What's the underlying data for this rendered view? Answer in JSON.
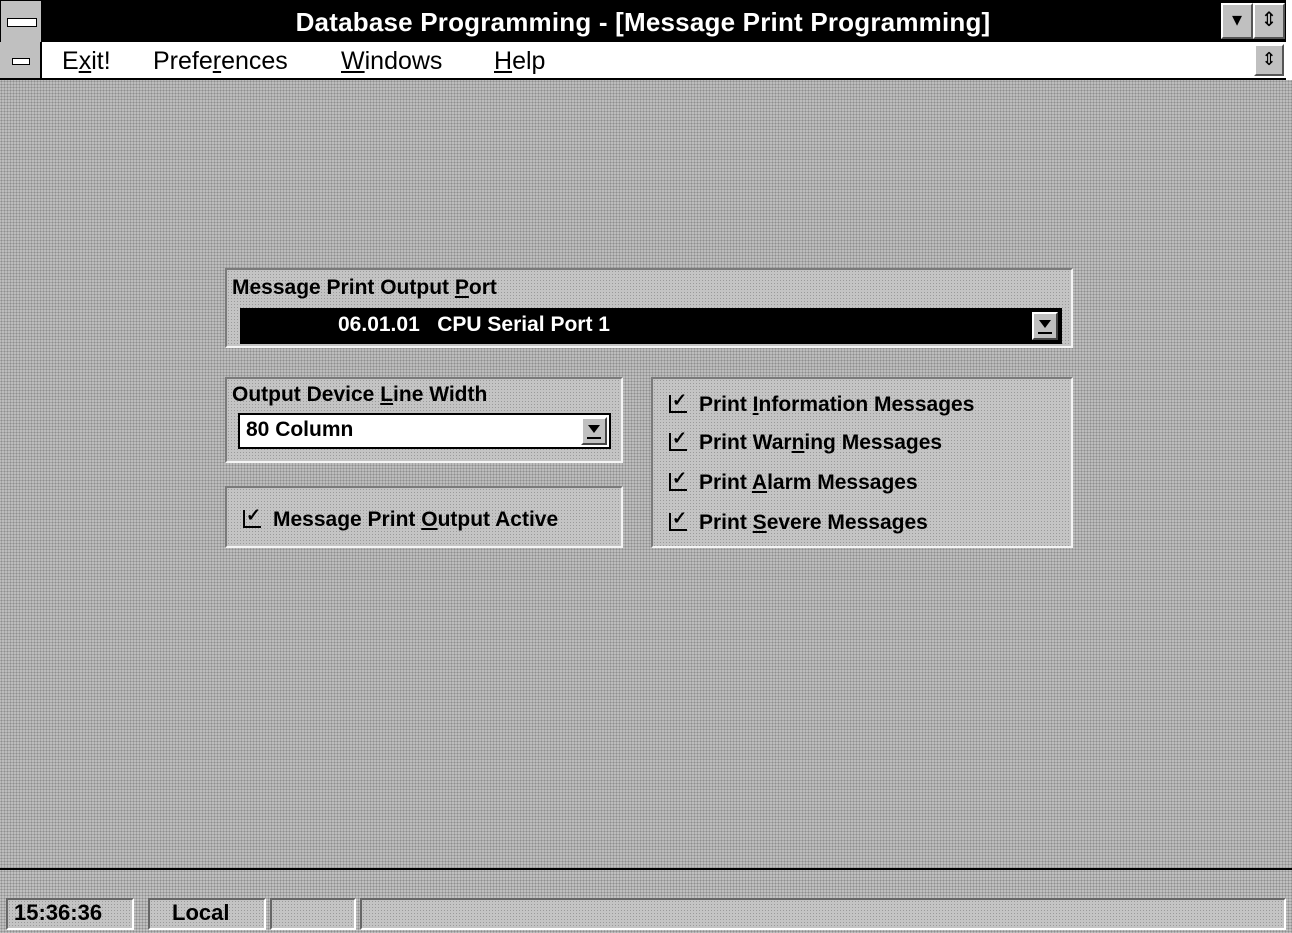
{
  "window": {
    "title": "Database Programming - [Message Print Programming]",
    "minimize_glyph": "▾",
    "restore_glyph": "⇕"
  },
  "menu": {
    "exit": {
      "pre": "E",
      "accel": "x",
      "post": "it!"
    },
    "preferences": {
      "pre": "Prefe",
      "accel": "r",
      "post": "ences"
    },
    "windows": {
      "pre": "",
      "accel": "W",
      "post": "indows"
    },
    "help": {
      "pre": "",
      "accel": "H",
      "post": "elp"
    },
    "restore_glyph": "⇕"
  },
  "output_port": {
    "label": {
      "pre": "Message Print Output ",
      "accel": "P",
      "post": "ort"
    },
    "value": "06.01.01   CPU Serial Port 1"
  },
  "line_width": {
    "label": {
      "pre": "Output Device ",
      "accel": "L",
      "post": "ine Width"
    },
    "value": "80 Column"
  },
  "output_active": {
    "label": {
      "pre": "Message Print ",
      "accel": "O",
      "post": "utput Active"
    },
    "checked": true
  },
  "message_types": [
    {
      "pre": "Print ",
      "accel": "I",
      "post": "nformation Messages",
      "checked": true
    },
    {
      "pre": "Print War",
      "accel": "n",
      "post": "ing Messages",
      "checked": true
    },
    {
      "pre": "Print ",
      "accel": "A",
      "post": "larm Messages",
      "checked": true
    },
    {
      "pre": "Print ",
      "accel": "S",
      "post": "evere Messages",
      "checked": true
    }
  ],
  "status": {
    "time": "15:36:36",
    "mode": "Local"
  },
  "colors": {
    "title_bar": "#000000",
    "selection": "#000000",
    "desktop": "#bcbcbc"
  }
}
